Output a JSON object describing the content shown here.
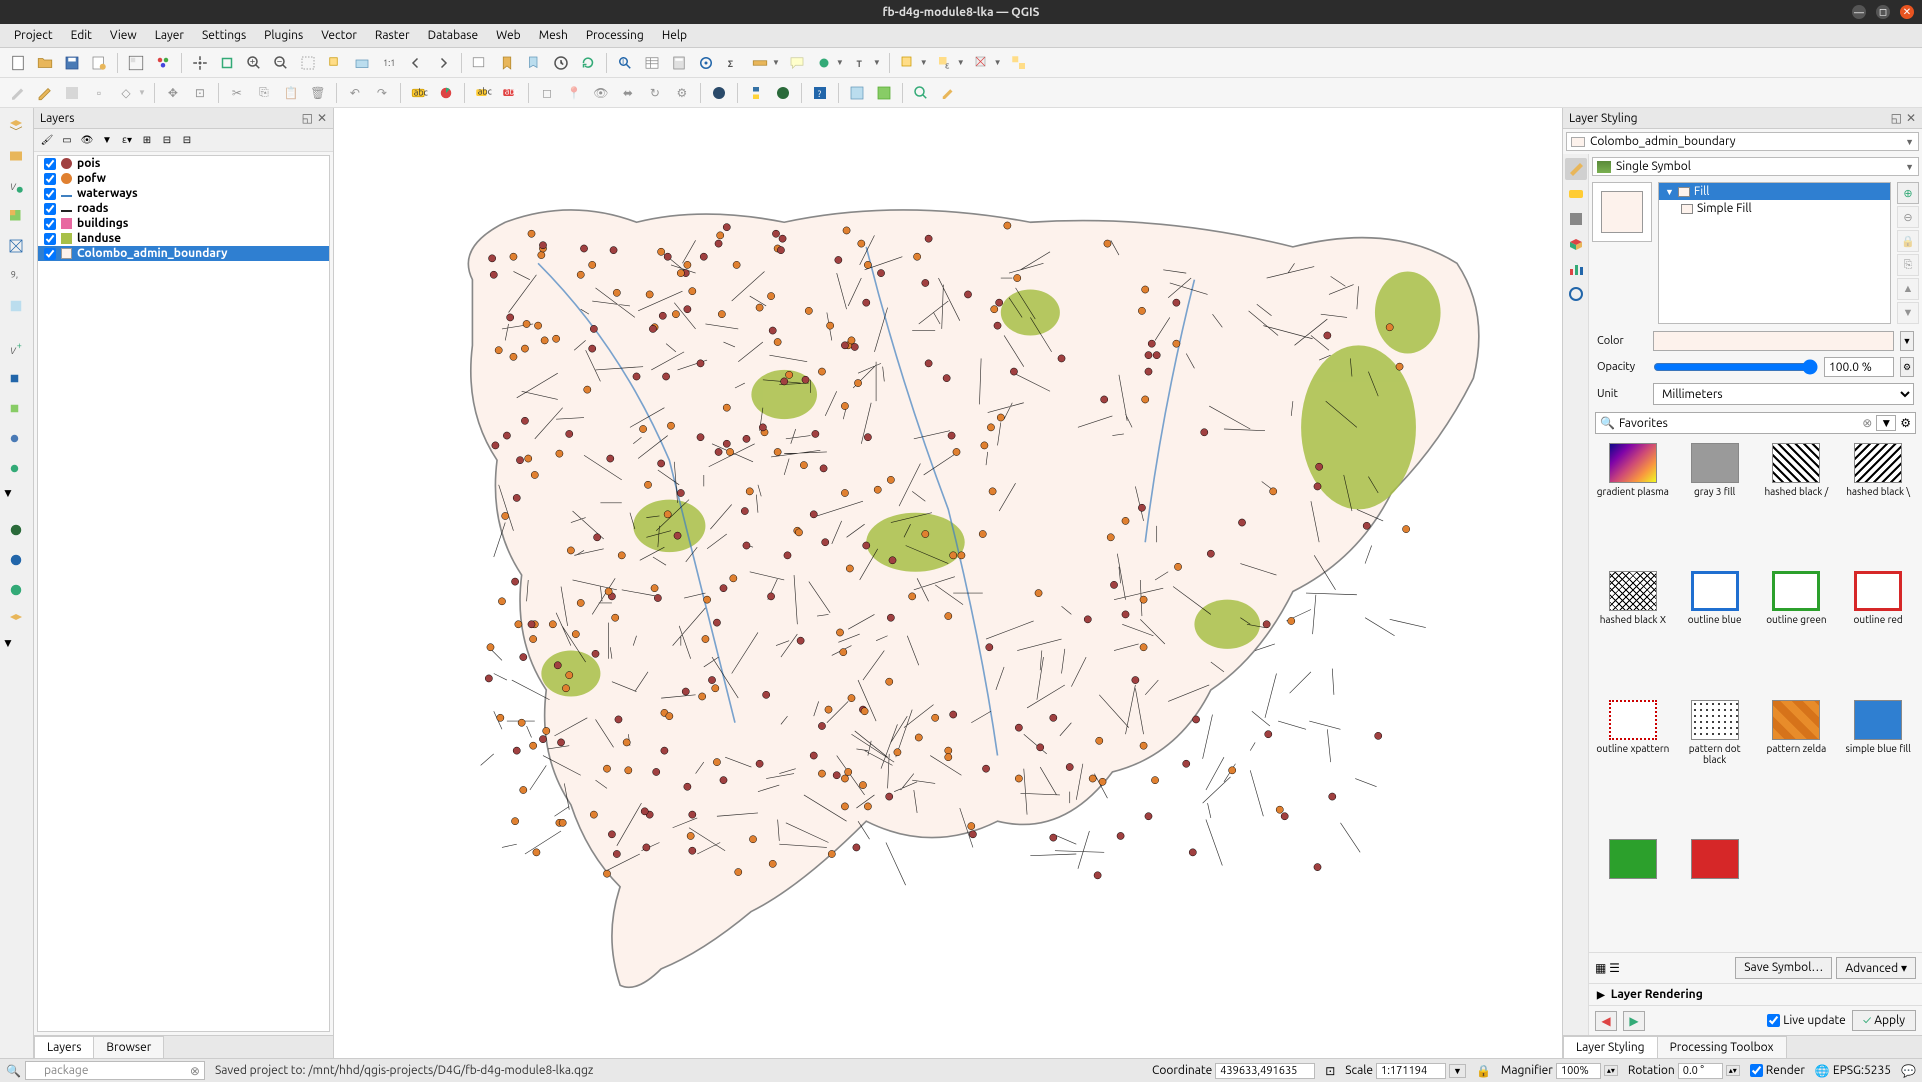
{
  "window": {
    "title": "fb-d4g-module8-lka — QGIS"
  },
  "menu": [
    "Project",
    "Edit",
    "View",
    "Layer",
    "Settings",
    "Plugins",
    "Vector",
    "Raster",
    "Database",
    "Web",
    "Mesh",
    "Processing",
    "Help"
  ],
  "panels": {
    "layers_title": "Layers",
    "layers_tabs": [
      "Layers",
      "Browser"
    ],
    "styling_title": "Layer Styling",
    "styling_tabs": [
      "Layer Styling",
      "Processing Toolbox"
    ]
  },
  "layers": [
    {
      "name": "pois",
      "sym": "dot-brown",
      "checked": true
    },
    {
      "name": "pofw",
      "sym": "dot-orange",
      "checked": true
    },
    {
      "name": "waterways",
      "sym": "line-blue",
      "checked": true
    },
    {
      "name": "roads",
      "sym": "line-black",
      "checked": true
    },
    {
      "name": "buildings",
      "sym": "sq-pink",
      "checked": true
    },
    {
      "name": "landuse",
      "sym": "sq-green",
      "checked": true
    },
    {
      "name": "Colombo_admin_boundary",
      "sym": "sq-beige",
      "checked": true,
      "selected": true
    }
  ],
  "styling": {
    "active_layer": "Colombo_admin_boundary",
    "symbol_type": "Single Symbol",
    "fill_label": "Fill",
    "simple_fill_label": "Simple Fill",
    "color_label": "Color",
    "opacity_label": "Opacity",
    "opacity_value": "100.0 %",
    "unit_label": "Unit",
    "unit_value": "Millimeters",
    "search_value": "Favorites",
    "save_symbol": "Save Symbol…",
    "advanced": "Advanced",
    "layer_rendering": "Layer Rendering",
    "live_update": "Live update",
    "apply": "Apply"
  },
  "swatches": [
    {
      "name": "gradient plasma",
      "style": "background:linear-gradient(135deg,#0d0887,#7e03a8,#cc4778,#f89540,#f0f921)"
    },
    {
      "name": "gray 3 fill",
      "style": "background:#9a9a9a"
    },
    {
      "name": "hashed black /",
      "style": "background:repeating-linear-gradient(45deg,#000 0 2px,#fff 2px 6px)"
    },
    {
      "name": "hashed black \\",
      "style": "background:repeating-linear-gradient(-45deg,#000 0 2px,#fff 2px 6px)"
    },
    {
      "name": "hashed black X",
      "style": "background:repeating-linear-gradient(45deg,#000 0 1px,transparent 1px 5px),repeating-linear-gradient(-45deg,#000 0 1px,#fff 1px 5px)"
    },
    {
      "name": "outline blue",
      "style": "background:#fff;border:3px solid #1f6fd0"
    },
    {
      "name": "outline green",
      "style": "background:#fff;border:3px solid #2ca02c"
    },
    {
      "name": "outline red",
      "style": "background:#fff;border:3px solid #d62728"
    },
    {
      "name": "outline xpattern",
      "style": "background:#fff;border:2px dotted #c00"
    },
    {
      "name": "pattern dot black",
      "style": "background:radial-gradient(#000 1px,#fff 1px);background-size:6px 6px"
    },
    {
      "name": "pattern zelda",
      "style": "background:repeating-linear-gradient(45deg,#e88c2a 0 8px,#d6731a 8px 16px)"
    },
    {
      "name": "simple blue fill",
      "style": "background:#2f7fd1"
    },
    {
      "name": "",
      "style": "background:#2ca02c"
    },
    {
      "name": "",
      "style": "background:#d62728"
    }
  ],
  "status": {
    "search_placeholder": "package",
    "saved_msg": "Saved project to: /mnt/hhd/qgis-projects/D4G/fb-d4g-module8-lka.qgz",
    "coord_label": "Coordinate",
    "coord_value": "439633,491635",
    "scale_label": "Scale",
    "scale_value": "1:171194",
    "magnifier_label": "Magnifier",
    "magnifier_value": "100%",
    "rotation_label": "Rotation",
    "rotation_value": "0.0 °",
    "render_label": "Render",
    "crs": "EPSG:5235"
  }
}
